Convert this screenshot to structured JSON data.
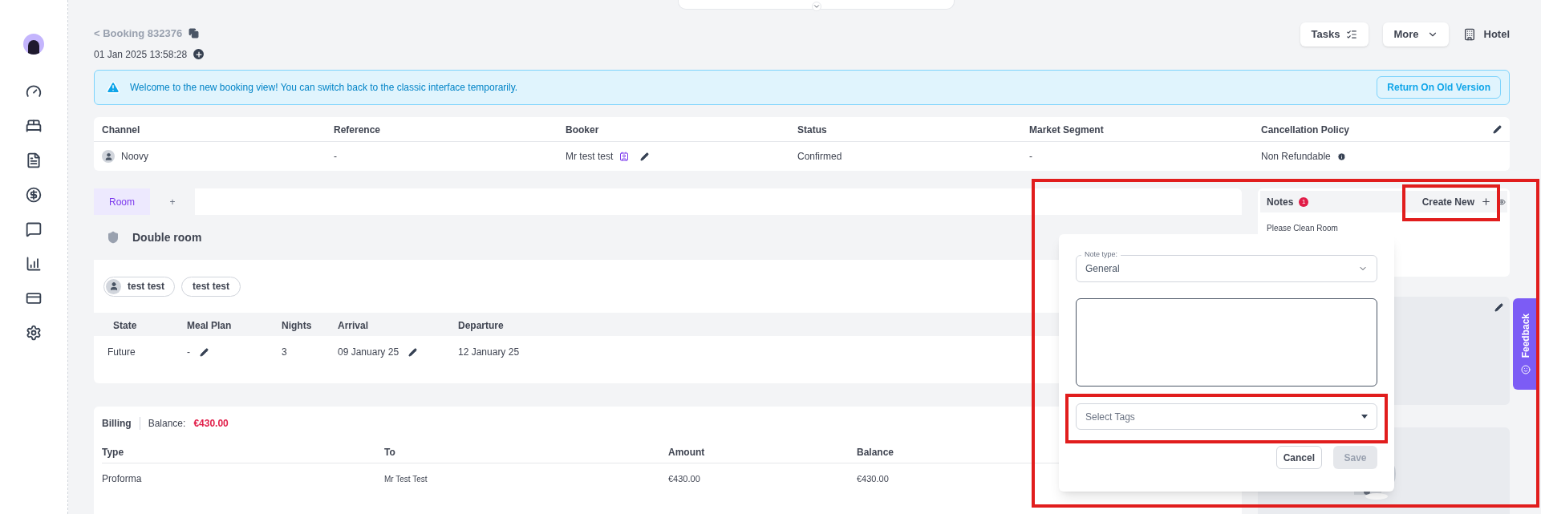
{
  "header": {
    "back_link": "< Booking 832376",
    "created": "01 Jan 2025 13:58:28"
  },
  "actions": {
    "tasks": "Tasks",
    "more": "More",
    "property": "Hotel"
  },
  "alert": {
    "message": "Welcome to the new booking view! You can switch back to the classic interface temporarily.",
    "button": "Return On Old Version"
  },
  "summary": {
    "columns": [
      "Channel",
      "Reference",
      "Booker",
      "Status",
      "Market Segment",
      "Cancellation Policy"
    ],
    "row": [
      {
        "kind": "channel",
        "text": "Noovy"
      },
      {
        "kind": "plain",
        "text": "-"
      },
      {
        "kind": "booker",
        "text": "Mr test test"
      },
      {
        "kind": "plain",
        "text": "Confirmed"
      },
      {
        "kind": "plain",
        "text": "-"
      },
      {
        "kind": "policy",
        "text": "Non Refundable"
      }
    ]
  },
  "room_tabs": [
    {
      "label": "Room",
      "selected": true
    },
    {
      "label": "+",
      "selected": false
    }
  ],
  "room": {
    "name": "Double room",
    "guests": [
      {
        "name": "test test",
        "avatar": true
      },
      {
        "name": "test test",
        "avatar": false
      }
    ],
    "columns": [
      "State",
      "Meal Plan",
      "Nights",
      "Arrival",
      "Departure"
    ],
    "row": [
      {
        "text": "Future",
        "editable": false
      },
      {
        "text": "-",
        "editable": true
      },
      {
        "text": "3",
        "editable": false
      },
      {
        "text": "09 January 25",
        "editable": true
      },
      {
        "text": "12 January 25",
        "editable": false
      }
    ]
  },
  "billing": {
    "title": "Billing",
    "balance_label": "Balance:",
    "balance": "€430.00",
    "columns": [
      "Type",
      "To",
      "Amount",
      "Balance"
    ],
    "rows": [
      [
        "Proforma",
        "Mr Test Test",
        "€430.00",
        "€430.00"
      ]
    ]
  },
  "notes": {
    "title": "Notes",
    "count": "1",
    "create": "Create New",
    "items": [
      "Please Clean Room"
    ]
  },
  "note_form": {
    "type_label": "Note type:",
    "type_value": "General",
    "tags_placeholder": "Select Tags",
    "cancel": "Cancel",
    "save": "Save",
    "save_disabled": true
  },
  "feedback": "Feedback"
}
